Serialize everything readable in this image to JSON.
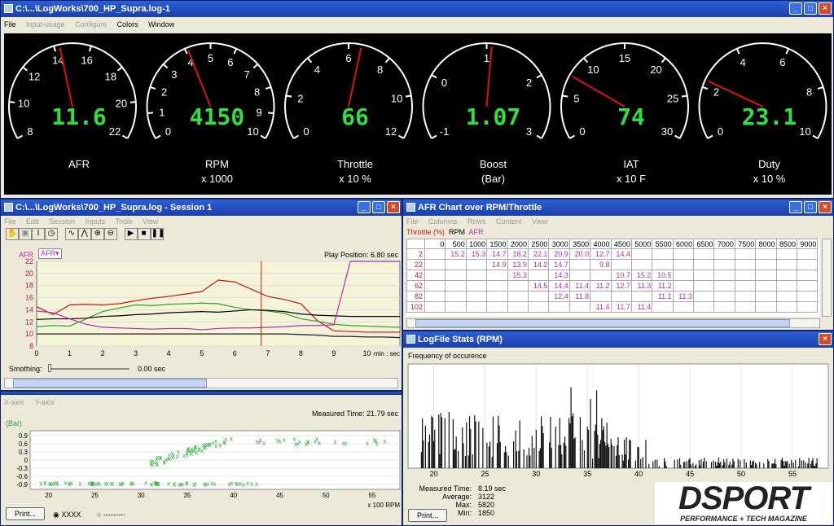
{
  "main": {
    "title": "C:\\...\\LogWorks\\700_HP_Supra.log-1",
    "menu": [
      "File",
      "Input-usage",
      "Configure",
      "Colors",
      "Window"
    ]
  },
  "gauges": [
    {
      "label": "AFR",
      "sub": "",
      "value": "11.6",
      "ticks": [
        "8",
        "10",
        "12",
        "14",
        "16",
        "18",
        "20",
        "22"
      ],
      "needle": 0.45
    },
    {
      "label": "RPM",
      "sub": "x 1000",
      "value": "4150",
      "ticks": [
        "0",
        "1",
        "2",
        "3",
        "4",
        "5",
        "6",
        "7",
        "8",
        "9",
        "10"
      ],
      "needle": 0.41
    },
    {
      "label": "Throttle",
      "sub": "x 10 %",
      "value": "66",
      "ticks": [
        "0",
        "2",
        "4",
        "6",
        "8",
        "10",
        "12"
      ],
      "needle": 0.55
    },
    {
      "label": "Boost",
      "sub": "(Bar)",
      "value": "1.07",
      "ticks": [
        "-1",
        "0",
        "1",
        "2",
        "3"
      ],
      "needle": 0.52
    },
    {
      "label": "IAT",
      "sub": "x 10 F",
      "value": "74",
      "ticks": [
        "0",
        "5",
        "10",
        "15",
        "20",
        "25",
        "30"
      ],
      "needle": 0.25
    },
    {
      "label": "Duty",
      "sub": "x 10 %",
      "value": "23.1",
      "ticks": [
        "0",
        "2",
        "4",
        "6",
        "8",
        "10"
      ],
      "needle": 0.23
    }
  ],
  "session": {
    "title": "C:\\...\\LogWorks\\700_HP_Supra.log - Session 1",
    "menu": [
      "File",
      "Edit",
      "Session",
      "Inputs",
      "Tools",
      "View"
    ],
    "channel": "AFR",
    "selector": "AFR",
    "play": "Play Position: 6.80 sec",
    "y_ticks": [
      "22",
      "20",
      "18",
      "16",
      "14",
      "12",
      "10",
      "8"
    ],
    "x_ticks": [
      "0",
      "1",
      "2",
      "3",
      "4",
      "5",
      "6",
      "7",
      "8",
      "9",
      "10"
    ],
    "x_unit": "min : sec",
    "smoothing_label": "Smothing:",
    "smoothing_value": "0.00 sec",
    "cursor_x": 6.8
  },
  "chart_data": [
    {
      "type": "line",
      "x": [
        0,
        0.5,
        1,
        1.5,
        2,
        2.5,
        3,
        3.5,
        4,
        4.5,
        5,
        5.5,
        6,
        6.5,
        7,
        7.5,
        8,
        8.5,
        9,
        9.5,
        10,
        10.5,
        11
      ],
      "series": [
        {
          "color": "#d01010",
          "values": [
            14.5,
            13.2,
            14.8,
            14.9,
            14.8,
            15,
            15.5,
            15.9,
            16.2,
            16.6,
            17,
            18.9,
            18.6,
            17.4,
            16.2,
            15.7,
            15,
            12.2,
            10.5,
            10.4,
            10.3,
            10.3,
            10.3
          ]
        },
        {
          "color": "#30a030",
          "values": [
            11.2,
            11.4,
            11.3,
            12.5,
            13.7,
            14.3,
            14.8,
            14.7,
            14.9,
            15,
            15.1,
            15,
            14.4,
            14,
            13.8,
            13.4,
            12.5,
            12.1,
            11.6,
            11.4,
            11.3,
            11.2,
            11.1
          ]
        },
        {
          "color": "#000000",
          "values": [
            12.4,
            12.5,
            12.5,
            12.6,
            12.9,
            13,
            13.2,
            13.3,
            13.5,
            13.6,
            13.7,
            13.6,
            13.8,
            14,
            13.9,
            13.7,
            13.3,
            13.1,
            13,
            12.9,
            12.9,
            12.9,
            12.9
          ]
        },
        {
          "color": "#b030b0",
          "values": [
            13.8,
            13.5,
            12.5,
            11.6,
            11.1,
            11,
            10.9,
            10.8,
            10.9,
            10.9,
            10.7,
            10.9,
            11,
            11,
            11.1,
            11.2,
            11.4,
            11.4,
            11.5,
            22,
            22,
            22,
            22
          ]
        },
        {
          "color": "#202020",
          "values": [
            10,
            10,
            10,
            10,
            10,
            10,
            10,
            10,
            10,
            10,
            10,
            10,
            10,
            10,
            10,
            10,
            9.9,
            9.8,
            9.6,
            9.6,
            9.5,
            9.5,
            9.4
          ]
        }
      ]
    },
    {
      "type": "scatter",
      "ylabel": "(Bar)",
      "y_ticks": [
        "0.9",
        "0.6",
        "0.3",
        "0",
        "-0.3",
        "-0.6",
        "-0.9"
      ],
      "x_ticks": [
        "20",
        "25",
        "30",
        "35",
        "40",
        "45",
        "50",
        "55"
      ],
      "x_unit": "x 100 RPM",
      "measured": "Measured Time: 21.79 sec",
      "color": "#30b040"
    },
    {
      "type": "bar",
      "title": "Frequency of occurence",
      "x_ticks": [
        "20",
        "25",
        "30",
        "35",
        "40",
        "45",
        "50",
        "55"
      ],
      "x_unit": "x 100 RPM"
    }
  ],
  "scatterwin": {
    "menu": [
      "X-axis",
      "Y-axis"
    ],
    "print": "Print...",
    "radio1": "XXXX",
    "radio2": "---------"
  },
  "afrwin": {
    "title": "AFR Chart over RPM/Throttle",
    "menu": [
      "File",
      "Columns",
      "Rows",
      "Content",
      "View"
    ],
    "h1": "Throttle (%)",
    "h2": "RPM",
    "h3": "AFR",
    "cols": [
      "0",
      "500",
      "1000",
      "1500",
      "2000",
      "2500",
      "3000",
      "3500",
      "4000",
      "4500",
      "5000",
      "5500",
      "6000",
      "6500",
      "7000",
      "7500",
      "8000",
      "8500",
      "9000"
    ],
    "rows": [
      {
        "h": "2",
        "c": [
          "",
          "15.2",
          "15.3",
          "14.7",
          "18.2",
          "22.1",
          "20.9",
          "20.0",
          "12.7",
          "14.4",
          "",
          "",
          "",
          "",
          "",
          "",
          "",
          "",
          ""
        ]
      },
      {
        "h": "22",
        "c": [
          "",
          "",
          "",
          "14.9",
          "13.9",
          "14.2",
          "14.7",
          "",
          "9.8",
          "",
          "",
          "",
          "",
          "",
          "",
          "",
          "",
          "",
          ""
        ]
      },
      {
        "h": "42",
        "c": [
          "",
          "",
          "",
          "",
          "15.3",
          "",
          "14.3",
          "",
          "",
          "10.7",
          "15.2",
          "10.5",
          "",
          "",
          "",
          "",
          "",
          "",
          ""
        ]
      },
      {
        "h": "62",
        "c": [
          "",
          "",
          "",
          "",
          "",
          "14.5",
          "14.4",
          "11.4",
          "11.2",
          "12.7",
          "11.3",
          "11.2",
          "",
          "",
          "",
          "",
          "",
          "",
          ""
        ]
      },
      {
        "h": "82",
        "c": [
          "",
          "",
          "",
          "",
          "",
          "",
          "12.4",
          "11.8",
          "",
          "",
          "",
          "11.1",
          "11.3",
          "",
          "",
          "",
          "",
          "",
          ""
        ]
      },
      {
        "h": "102",
        "c": [
          "",
          "",
          "",
          "",
          "",
          "",
          "",
          "",
          "11.4",
          "11.7",
          "11.4",
          "",
          "",
          "",
          "",
          "",
          "",
          "",
          ""
        ]
      }
    ]
  },
  "stats": {
    "title": "LogFile Stats (RPM)",
    "labels": [
      "Measured Time:",
      "Average:",
      "Max:",
      "Min:"
    ],
    "values": [
      "8.19 sec",
      "3122",
      "5820",
      "1850"
    ],
    "print": "Print..."
  },
  "logo": {
    "main": "DSPORT",
    "tag": "PERFORMANCE + TECH MAGAZINE"
  }
}
